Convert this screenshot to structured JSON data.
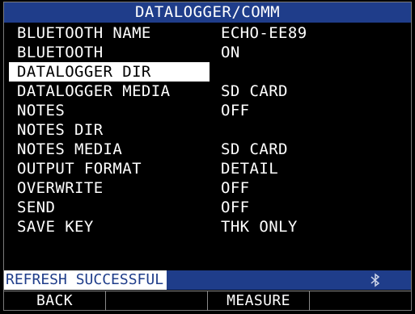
{
  "title": "DATALOGGER/COMM",
  "menu": [
    {
      "label": "BLUETOOTH NAME",
      "value": "ECHO-EE89"
    },
    {
      "label": "BLUETOOTH",
      "value": "ON"
    },
    {
      "label": "DATALOGGER DIR",
      "value": ""
    },
    {
      "label": "DATALOGGER MEDIA",
      "value": "SD CARD"
    },
    {
      "label": "NOTES",
      "value": "OFF"
    },
    {
      "label": "NOTES DIR",
      "value": ""
    },
    {
      "label": "NOTES MEDIA",
      "value": "SD CARD"
    },
    {
      "label": "OUTPUT FORMAT",
      "value": "DETAIL"
    },
    {
      "label": "OVERWRITE",
      "value": "OFF"
    },
    {
      "label": "SEND",
      "value": "OFF"
    },
    {
      "label": "SAVE KEY",
      "value": "THK ONLY"
    }
  ],
  "status": {
    "message": "REFRESH SUCCESSFUL",
    "icon": "bluetooth-icon"
  },
  "softkeys": [
    {
      "label": "BACK"
    },
    {
      "label": ""
    },
    {
      "label": "MEASURE"
    },
    {
      "label": ""
    }
  ],
  "colors": {
    "title_bar": "#1f3d8a",
    "status_bar": "#1f3d8a",
    "selected_bg": "#ffffff",
    "background": "#000000"
  }
}
